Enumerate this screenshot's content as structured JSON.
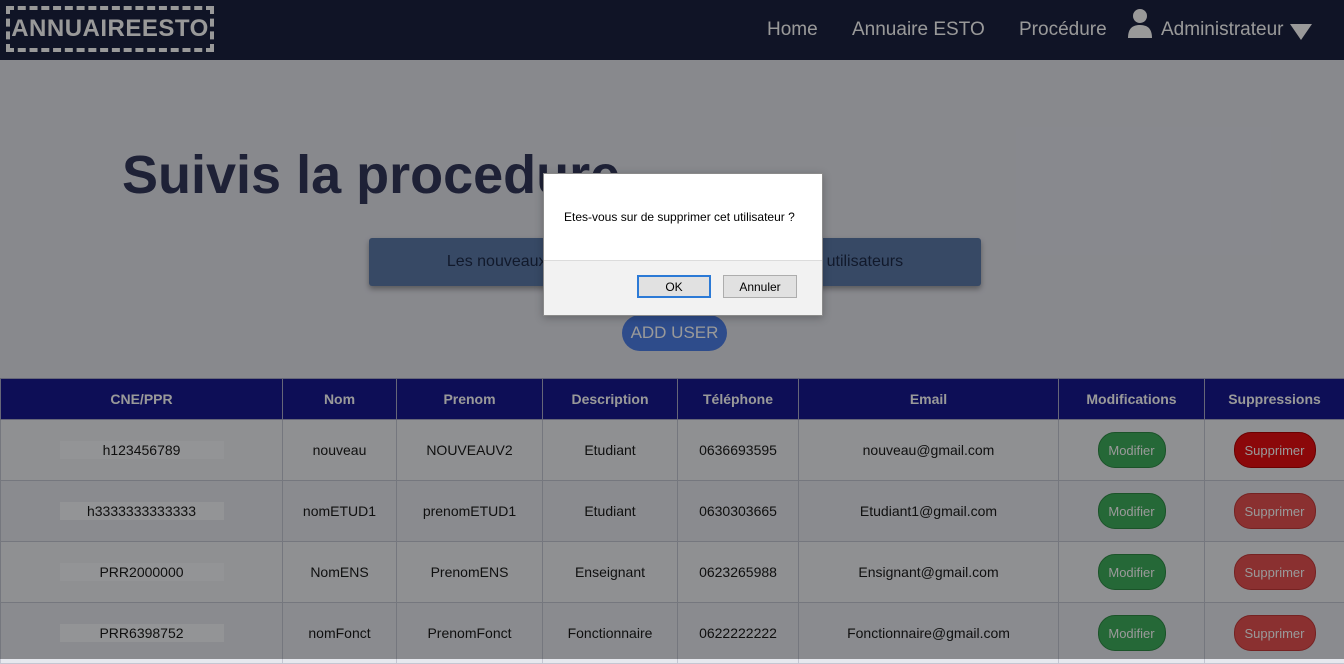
{
  "navbar": {
    "logo": "ANNUAIREESTO",
    "links": [
      "Home",
      "Annuaire ESTO",
      "Procédure"
    ],
    "user_label": "Administrateur",
    "user_icon": "user-icon",
    "menu_icon": "caret-down-icon"
  },
  "page": {
    "title": "Suivis la procedure",
    "banner_text": "Les nouveaux d                                                            utilisateurs",
    "add_user_label": "ADD USER"
  },
  "table": {
    "headers": [
      "CNE/PPR",
      "Nom",
      "Prenom",
      "Description",
      "Téléphone",
      "Email",
      "Modifications",
      "Suppressions"
    ],
    "rows": [
      {
        "cne": "h123456789",
        "nom": "nouveau",
        "prenom": "NOUVEAUV2",
        "description": "Etudiant",
        "telephone": "0636693595",
        "email": "nouveau@gmail.com",
        "modify": "Modifier",
        "delete": "Supprimer"
      },
      {
        "cne": "h3333333333333",
        "nom": "nomETUD1",
        "prenom": "prenomETUD1",
        "description": "Etudiant",
        "telephone": "0630303665",
        "email": "Etudiant1@gmail.com",
        "modify": "Modifier",
        "delete": "Supprimer"
      },
      {
        "cne": "PRR2000000",
        "nom": "NomENS",
        "prenom": "PrenomENS",
        "description": "Enseignant",
        "telephone": "0623265988",
        "email": "Ensignant@gmail.com",
        "modify": "Modifier",
        "delete": "Supprimer"
      },
      {
        "cne": "PRR6398752",
        "nom": "nomFonct",
        "prenom": "PrenomFonct",
        "description": "Fonctionnaire",
        "telephone": "0622222222",
        "email": "Fonctionnaire@gmail.com",
        "modify": "Modifier",
        "delete": "Supprimer"
      }
    ]
  },
  "dialog": {
    "message": "Etes-vous sur de supprimer cet utilisateur ?",
    "ok_label": "OK",
    "cancel_label": "Annuler"
  },
  "colors": {
    "navbar": "#1c2240",
    "table_header": "#16188f",
    "modify_button": "#3fae5c",
    "delete_button": "#e65050",
    "add_button": "#4d7fe8"
  }
}
